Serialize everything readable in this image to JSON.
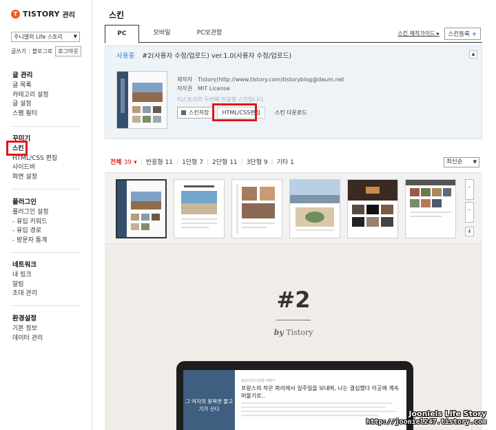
{
  "brand": {
    "logo_letter": "T",
    "name": "TISTORY",
    "sub": "관리"
  },
  "sidebar": {
    "blog_select": "주니엘의 Life 스토리",
    "quick_links": [
      "글쓰기",
      "블로그로"
    ],
    "logout": "로그아웃",
    "groups": [
      {
        "title": "글 관리",
        "items": [
          "글 목록",
          "카테고리 설정",
          "글 설정",
          "스팸 필터"
        ]
      },
      {
        "title": "꾸미기",
        "items": [
          "스킨",
          "HTML/CSS 편집",
          "사이드바",
          "화면 설정"
        ]
      },
      {
        "title": "플러그인",
        "items": [
          "플러그인 설정",
          "- 유입 키워드",
          "- 유입 경로",
          "- 방문자 통계"
        ]
      },
      {
        "title": "네트워크",
        "items": [
          "내 링크",
          "알림",
          "초대 관리"
        ]
      },
      {
        "title": "환경설정",
        "items": [
          "기본 정보",
          "데이터 관리"
        ]
      }
    ]
  },
  "main": {
    "title": "스킨",
    "tabs": [
      "PC",
      "모바일",
      "PC보관함"
    ],
    "guide_link": "스킨 제작가이드",
    "register_button": "스킨등록",
    "current": {
      "status": "사용중",
      "skin_title": "#2(사용자 수정/업로드) ver.1.0(사용자 수정/업로드)",
      "maker_label": "제작자",
      "maker_value": "Tistory(http://www.tistory.com)tistoryblog@daum.net",
      "license_label": "저작권",
      "license_value": "MIT License",
      "note": "티스토리의 두번째 반응형 스킨입니다.",
      "save_button": "스킨저장",
      "html_button": "HTML/CSS편집",
      "download_link": "스킨 다운로드"
    },
    "filters": [
      {
        "label": "전체",
        "count": "39"
      },
      {
        "label": "반응형",
        "count": "11"
      },
      {
        "label": "1단형",
        "count": "7"
      },
      {
        "label": "2단형",
        "count": "11"
      },
      {
        "label": "3단형",
        "count": "9"
      },
      {
        "label": "기타",
        "count": "1"
      }
    ],
    "sort": "최신순",
    "preview": {
      "number": "#2",
      "by_prefix": "by",
      "by_name": "Tistory",
      "laptop_left_text": "그 여자의 왕목엔 물고기가 산다",
      "laptop_tag": "일상다반사/유럽 여행기",
      "laptop_heading": "프랑스의 작은 파리에서 일주일을 보내며, 나는 결심했다 이곳에 계속 머물기로.."
    }
  },
  "watermark": {
    "title": "Jooniels Life Story",
    "url": "http://jooniel247.tistory.com"
  },
  "colors": {
    "accent_red": "#e0161b",
    "link_blue": "#3a7bd5",
    "brand_orange": "#f05a28"
  }
}
